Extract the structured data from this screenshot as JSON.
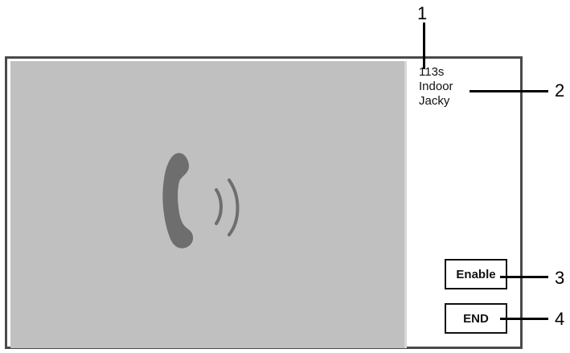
{
  "call": {
    "duration": "113s",
    "location": "Indoor",
    "caller": "Jacky"
  },
  "buttons": {
    "enable_label": "Enable",
    "end_label": "END"
  },
  "callouts": {
    "c1": "1",
    "c2": "2",
    "c3": "3",
    "c4": "4"
  },
  "colors": {
    "video_bg": "#c0c0c0",
    "icon": "#6e6e6e",
    "frame": "#4a4a4a"
  },
  "icons": {
    "center": "phone-ringing-icon"
  }
}
